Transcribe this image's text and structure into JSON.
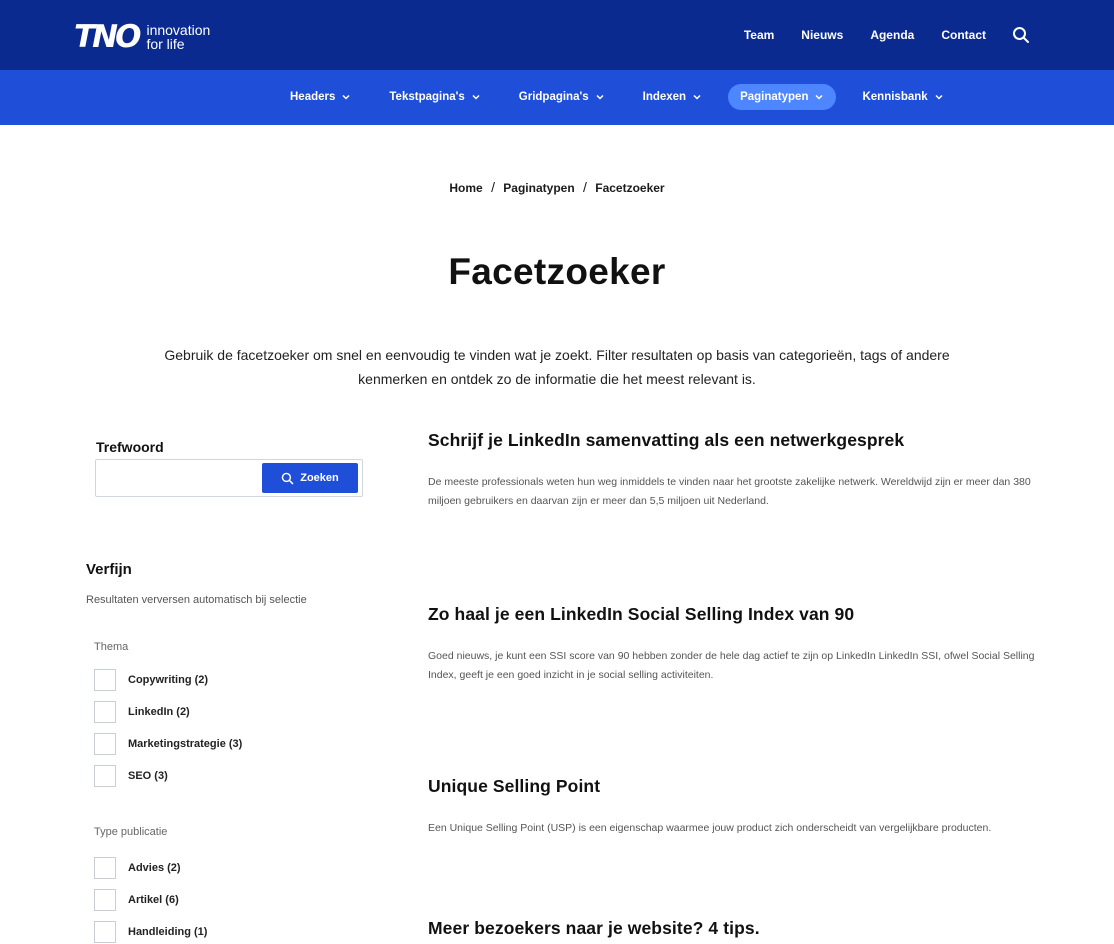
{
  "header": {
    "logo_mark": "TNO",
    "logo_tagline_1": "innovation",
    "logo_tagline_2": "for life",
    "top_links": [
      "Team",
      "Nieuws",
      "Agenda",
      "Contact"
    ]
  },
  "subnav": {
    "items": [
      {
        "label": "Headers"
      },
      {
        "label": "Tekstpagina's"
      },
      {
        "label": "Gridpagina's"
      },
      {
        "label": "Indexen"
      },
      {
        "label": "Paginatypen"
      },
      {
        "label": "Kennisbank"
      }
    ],
    "active": "Paginatypen"
  },
  "breadcrumb": {
    "home": "Home",
    "level1": "Paginatypen",
    "current": "Facetzoeker",
    "separator": "/"
  },
  "page": {
    "title": "Facetzoeker",
    "intro": "Gebruik de facetzoeker om snel en eenvoudig te vinden wat je zoekt. Filter resultaten op basis van categorieën, tags of andere kenmerken en ontdek zo de informatie die het meest relevant is."
  },
  "search": {
    "label": "Trefwoord",
    "value": "",
    "button_label": "Zoeken"
  },
  "refine": {
    "title": "Verfijn",
    "note": "Resultaten verversen automatisch bij selectie",
    "groups": [
      {
        "label": "Thema",
        "options": [
          "Copywriting (2)",
          "LinkedIn (2)",
          "Marketingstrategie (3)",
          "SEO (3)"
        ]
      },
      {
        "label": "Type publicatie",
        "options": [
          "Advies (2)",
          "Artikel (6)",
          "Handleiding (1)"
        ]
      }
    ]
  },
  "results": [
    {
      "title": "Schrijf je LinkedIn samenvatting als een netwerkgesprek",
      "summary": "De meeste professionals weten hun weg inmiddels te vinden naar het grootste zakelijke netwerk. Wereldwijd zijn er meer dan 380 miljoen gebruikers en daarvan zijn er meer dan 5,5 miljoen uit Nederland."
    },
    {
      "title": "Zo haal je een LinkedIn Social Selling Index van 90",
      "summary": "Goed nieuws, je kunt een SSI score van 90 hebben zonder de hele dag actief te zijn op LinkedIn LinkedIn SSI, ofwel Social Selling Index, geeft je een goed inzicht in je social selling activiteiten."
    },
    {
      "title": "Unique Selling Point",
      "summary": "Een Unique Selling Point (USP) is een eigenschap waarmee jouw product zich onderscheidt van vergelijkbare producten."
    },
    {
      "title": "Meer bezoekers naar je website? 4 tips.",
      "summary": ""
    }
  ],
  "colors": {
    "topbar": "#0b2a8f",
    "subnav": "#1f4fd8",
    "active_pill": "#4d86ff",
    "button": "#1f4fd8"
  },
  "icons": {
    "search": "search-icon",
    "dropdown": "chevron-down-icon"
  }
}
